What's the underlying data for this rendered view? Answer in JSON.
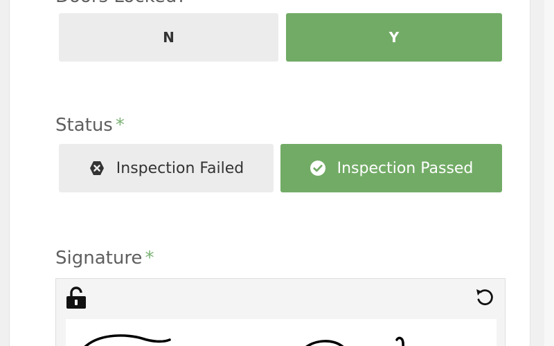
{
  "doors_locked": {
    "label": "Doors Locked?",
    "options": [
      {
        "label": "N",
        "selected": false
      },
      {
        "label": "Y",
        "selected": true
      }
    ]
  },
  "status": {
    "label": "Status",
    "required_mark": "*",
    "options": [
      {
        "label": "Inspection Failed",
        "icon": "times-hexagon-icon",
        "selected": false
      },
      {
        "label": "Inspection Passed",
        "icon": "check-circle-icon",
        "selected": true
      }
    ]
  },
  "signature": {
    "label": "Signature",
    "required_mark": "*",
    "lock_icon": "unlock-icon",
    "reset_icon": "undo-icon"
  },
  "colors": {
    "accent": "#72ab66",
    "required": "#7bb274",
    "unselected": "#ececec"
  }
}
